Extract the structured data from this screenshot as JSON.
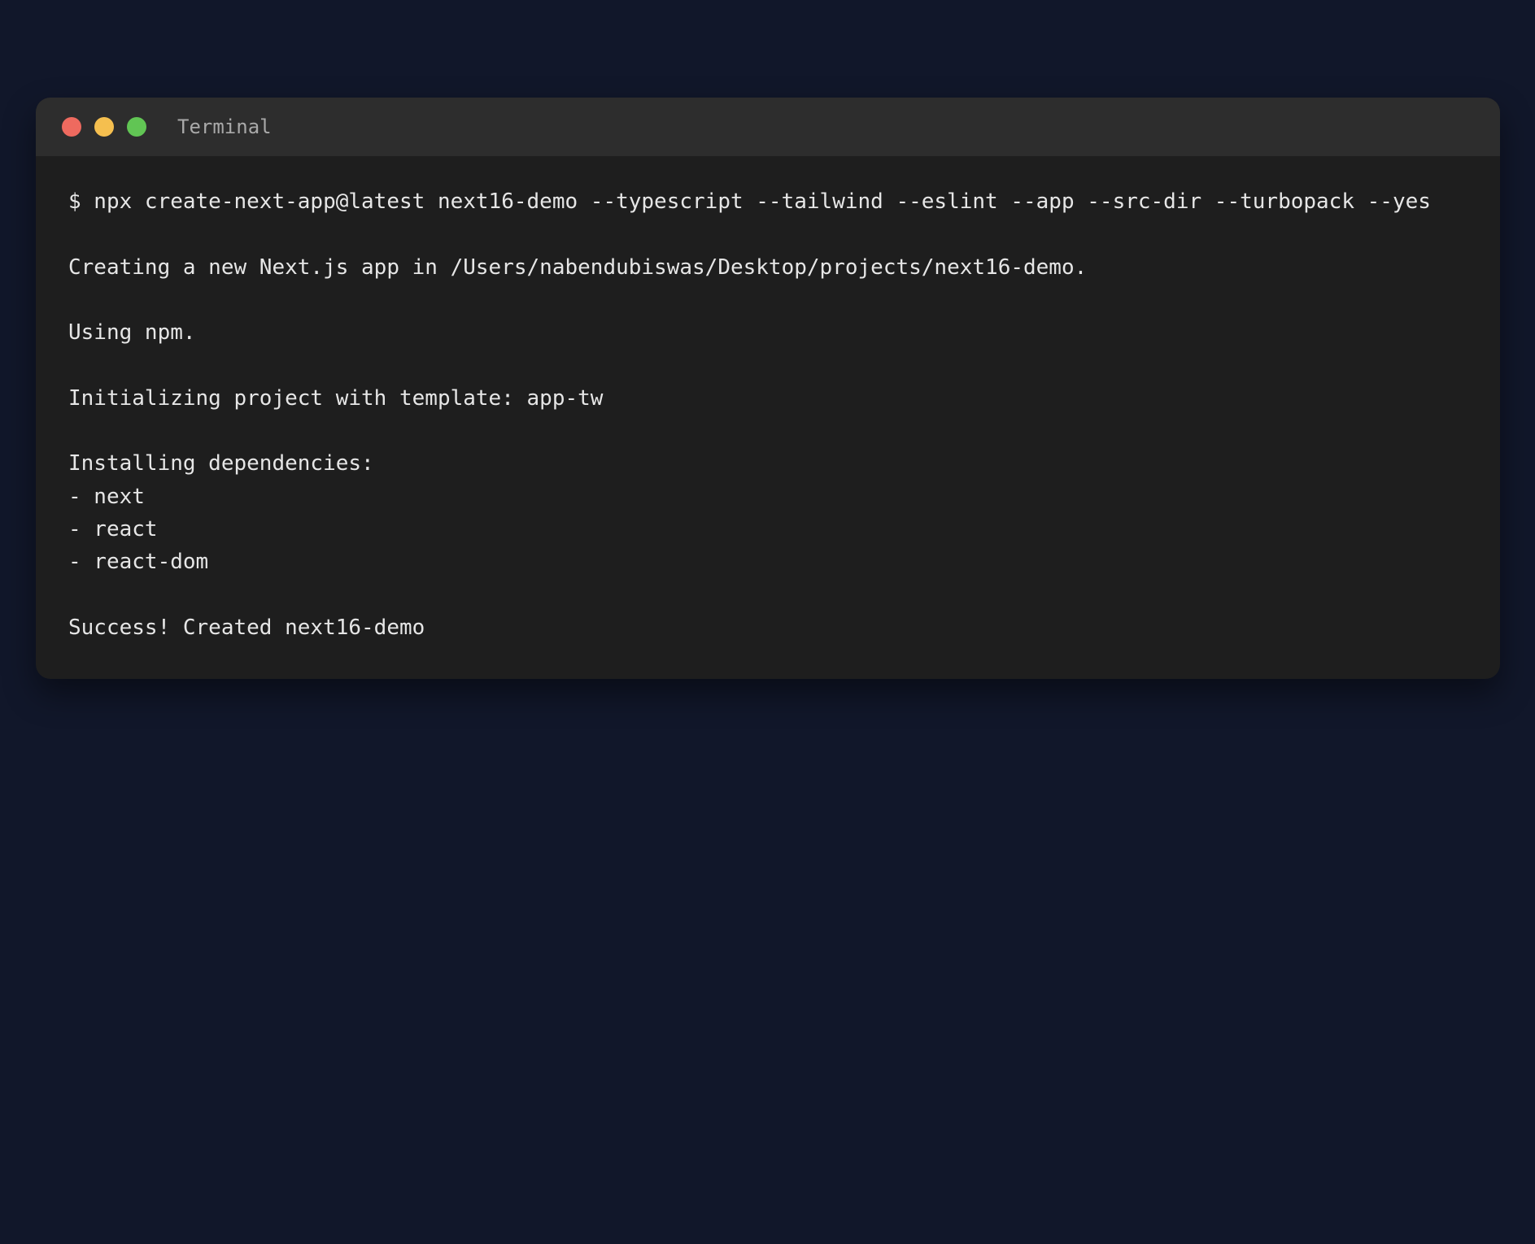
{
  "window": {
    "title": "Terminal",
    "colors": {
      "background": "#11172a",
      "window": "#1e1e1e",
      "title_bar": "#2d2d2d",
      "close": "#ee6a5f",
      "minimize": "#f5bf4f",
      "zoom": "#61c554",
      "text": "#e6e6e6"
    }
  },
  "terminal": {
    "lines": [
      "$ npx create-next-app@latest next16-demo --typescript --tailwind --eslint --app --src-dir --turbopack --yes",
      "",
      "Creating a new Next.js app in /Users/nabendubiswas/Desktop/projects/next16-demo.",
      "",
      "Using npm.",
      "",
      "Initializing project with template: app-tw",
      "",
      "Installing dependencies:",
      "- next",
      "- react",
      "- react-dom",
      "",
      "Success! Created next16-demo"
    ]
  }
}
